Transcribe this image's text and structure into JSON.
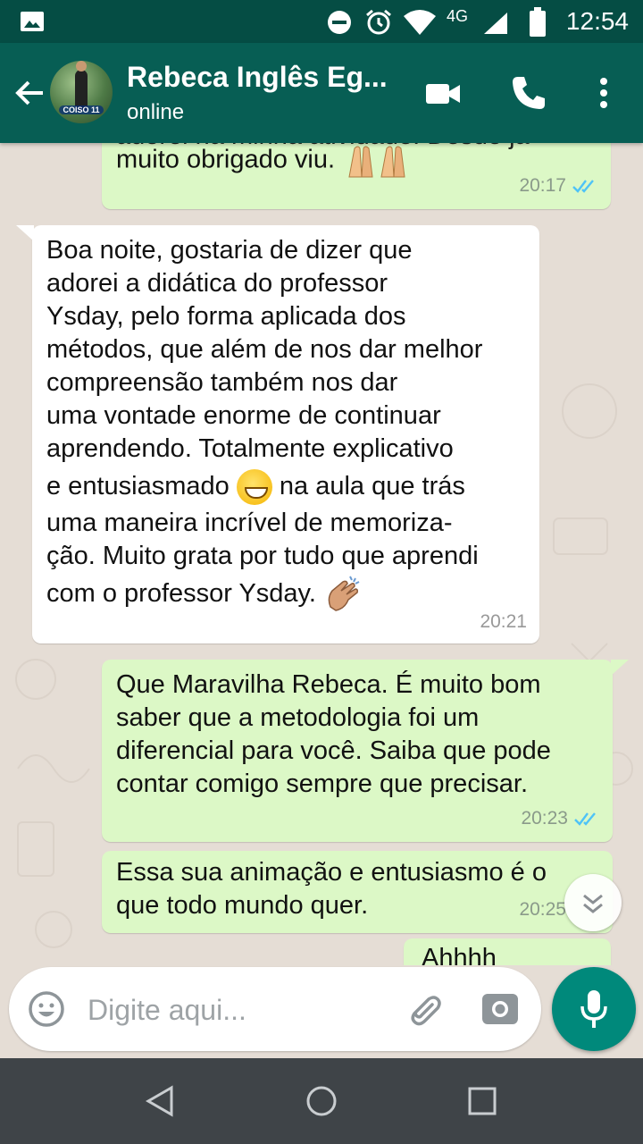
{
  "status_bar": {
    "time": "12:54",
    "network": "4G"
  },
  "header": {
    "contact_name": "Rebeca Inglês Eg...",
    "status": "online",
    "avatar_badge": "COISO 11"
  },
  "messages": [
    {
      "id": "m1",
      "direction": "out",
      "text_lines": [
        "adorei na minha atividade. Desde já",
        "muito obrigado viu. 🙏🙏"
      ],
      "time": "20:17",
      "read": true
    },
    {
      "id": "m2",
      "direction": "in",
      "text_lines": [
        "Boa noite, gostaria de dizer que",
        "adorei a didática do professor",
        "Ysday, pelo forma aplicada dos",
        "métodos, que além de nos dar melhor",
        "compreensão também nos dar",
        "uma vontade enorme de continuar",
        "aprendendo. Totalmente explicativo",
        "e entusiasmado",
        "na aula que trás",
        "uma maneira incrível de memoriza-",
        "ção. Muito grata por tudo que aprendi",
        "com o professor Ysday."
      ],
      "time": "20:21"
    },
    {
      "id": "m3",
      "direction": "out",
      "text_lines": [
        "Que Maravilha Rebeca. É muito bom",
        "saber que a metodologia foi um",
        "diferencial para você. Saiba que pode",
        "contar comigo sempre que precisar."
      ],
      "time": "20:23",
      "read": true
    },
    {
      "id": "m4",
      "direction": "out",
      "text_lines": [
        "Essa sua animação e entusiasmo é o",
        "que todo mundo quer."
      ],
      "time": "20:25"
    },
    {
      "id": "m5",
      "direction": "out",
      "text_lines": [
        "Ahhhh"
      ]
    }
  ],
  "composer": {
    "placeholder": "Digite aqui..."
  },
  "colors": {
    "header": "#075e54",
    "status_bar": "#054d44",
    "outgoing": "#dcf8c6",
    "incoming": "#ffffff",
    "accent": "#00897b",
    "read_ticks": "#4fc3f7"
  },
  "icons": [
    "back-arrow-icon",
    "video-call-icon",
    "phone-icon",
    "more-vert-icon",
    "emoji-icon",
    "attach-icon",
    "camera-icon",
    "mic-icon",
    "chevron-down-icon",
    "back-nav-icon",
    "home-nav-icon",
    "recents-nav-icon"
  ]
}
